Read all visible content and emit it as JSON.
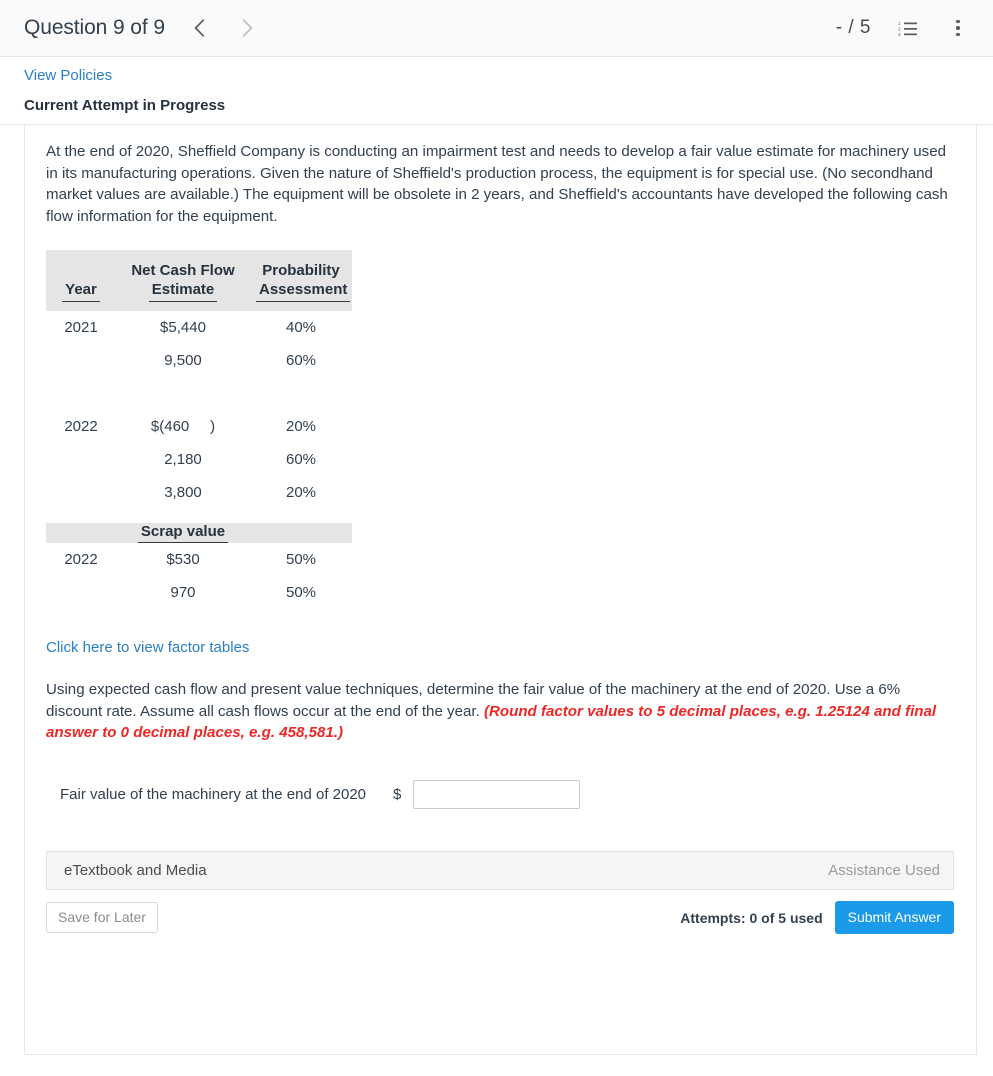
{
  "header": {
    "question_title": "Question 9 of 9",
    "prev_icon": "chevron-left-icon",
    "next_icon": "chevron-right-icon",
    "score": "- / 5",
    "list_icon": "numbered-list-icon",
    "menu_icon": "vertical-dots-menu-icon"
  },
  "policies": {
    "view_policies_label": "View Policies",
    "attempt_status": "Current Attempt in Progress"
  },
  "question": {
    "body": "At the end of 2020, Sheffield Company is conducting an impairment test and needs to develop a fair value estimate for machinery used in its manufacturing operations. Given the nature of Sheffield's production process, the equipment is for special use. (No secondhand market values are available.) The equipment will be obsolete in 2 years, and Sheffield's accountants have developed the following cash flow information for the equipment."
  },
  "cash_flow_table": {
    "headers": {
      "year": "Year",
      "net_cash_flow_line1": "Net Cash Flow",
      "net_cash_flow_line2": "Estimate",
      "probability_line1": "Probability",
      "probability_line2": "Assessment"
    },
    "groups": [
      {
        "year": "2021",
        "rows": [
          {
            "amount": "$5,440",
            "probability": "40%"
          },
          {
            "amount": "9,500",
            "probability": "60%"
          }
        ]
      },
      {
        "year": "2022",
        "rows": [
          {
            "amount": "$(460     )",
            "probability": "20%"
          },
          {
            "amount": "2,180",
            "probability": "60%"
          },
          {
            "amount": "3,800",
            "probability": "20%"
          }
        ]
      }
    ]
  },
  "scrap_table": {
    "header": "Scrap value",
    "year": "2022",
    "rows": [
      {
        "amount": "$530",
        "probability": "50%"
      },
      {
        "amount": "970",
        "probability": "50%"
      }
    ]
  },
  "factor_tables": {
    "link_label": "Click here to view factor tables"
  },
  "instructions": {
    "main": "Using expected cash flow and present value techniques, determine the fair value of the machinery at the end of 2020. Use a 6% discount rate. Assume all cash flows occur at the end of the year. ",
    "rounding_note": "(Round factor values to 5 decimal places, e.g. 1.25124 and final answer to 0 decimal places, e.g. 458,581.)"
  },
  "answer": {
    "label": "Fair value of the machinery at the end of 2020",
    "currency_symbol": "$",
    "value": "",
    "placeholder": ""
  },
  "etextbook": {
    "label": "eTextbook and Media",
    "assistance": "Assistance Used"
  },
  "footer": {
    "save_label": "Save for Later",
    "attempts": "Attempts: 0 of 5 used",
    "submit_label": "Submit Answer"
  },
  "colors": {
    "link_blue": "#2a7fc9",
    "submit_blue": "#1a9ae8",
    "note_red": "#ef2626",
    "table_header_gray": "#e5e5e5",
    "text_dark": "#33404e"
  }
}
